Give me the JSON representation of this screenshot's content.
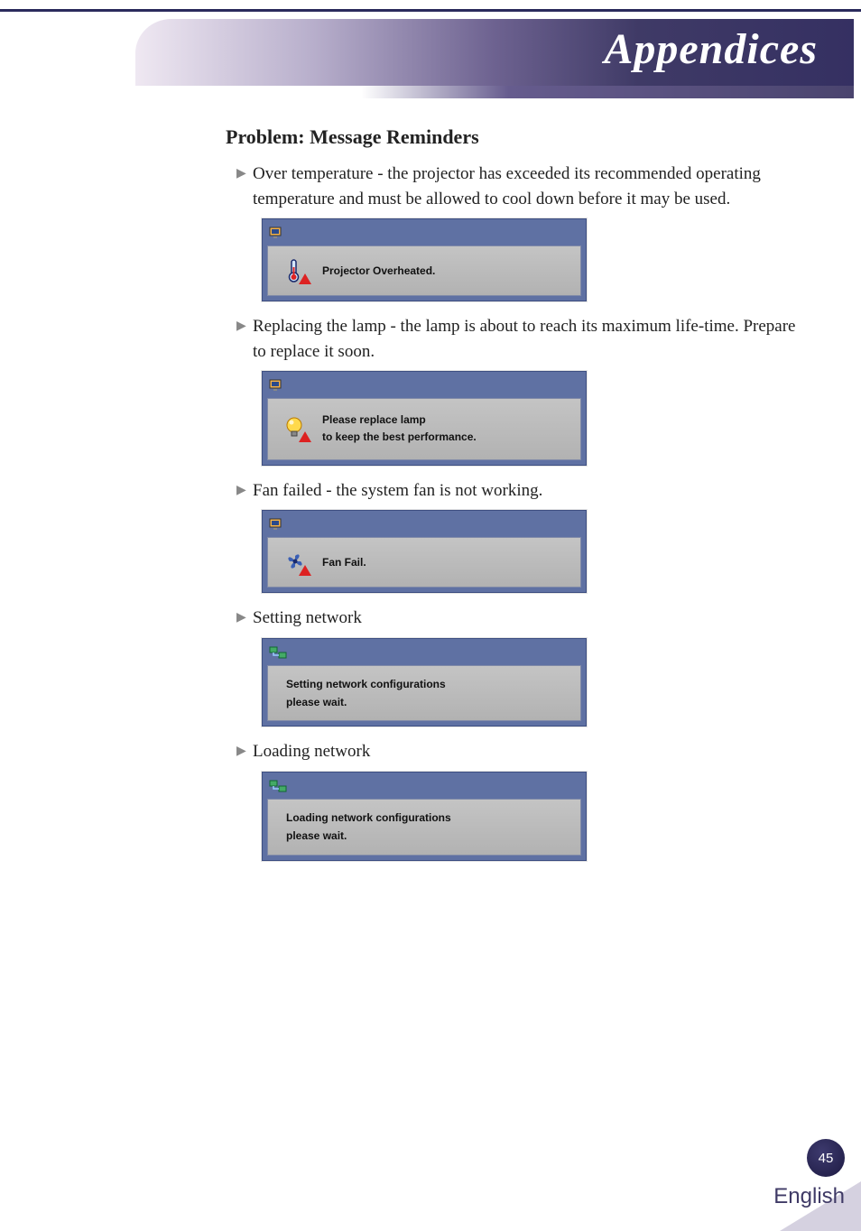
{
  "header": {
    "title": "Appendices"
  },
  "section": {
    "heading": "Problem: Message Reminders"
  },
  "items": [
    {
      "text": "Over temperature - the projector has exceeded its recommended operating temperature and must be allowed to cool down before it may be used.",
      "dialog": {
        "icon": "thermometer",
        "lines": [
          "Projector Overheated."
        ],
        "title_icon": "monitor"
      }
    },
    {
      "text": "Replacing the lamp - the lamp is about to reach its maximum life-time. Prepare to replace  it soon.",
      "dialog": {
        "icon": "lamp",
        "lines": [
          "Please replace lamp",
          "to keep the best performance."
        ],
        "title_icon": "monitor"
      }
    },
    {
      "text": "Fan failed - the system fan is not working.",
      "dialog": {
        "icon": "fan",
        "lines": [
          "Fan Fail."
        ],
        "title_icon": "monitor"
      }
    },
    {
      "text": "Setting network",
      "dialog": {
        "icon": null,
        "lines": [
          "Setting network configurations",
          "please wait."
        ],
        "title_icon": "network",
        "net": true
      }
    },
    {
      "text": "Loading network",
      "dialog": {
        "icon": null,
        "lines": [
          "Loading network configurations",
          "please wait."
        ],
        "title_icon": "network",
        "net": true
      }
    }
  ],
  "footer": {
    "page": "45",
    "language": "English"
  }
}
